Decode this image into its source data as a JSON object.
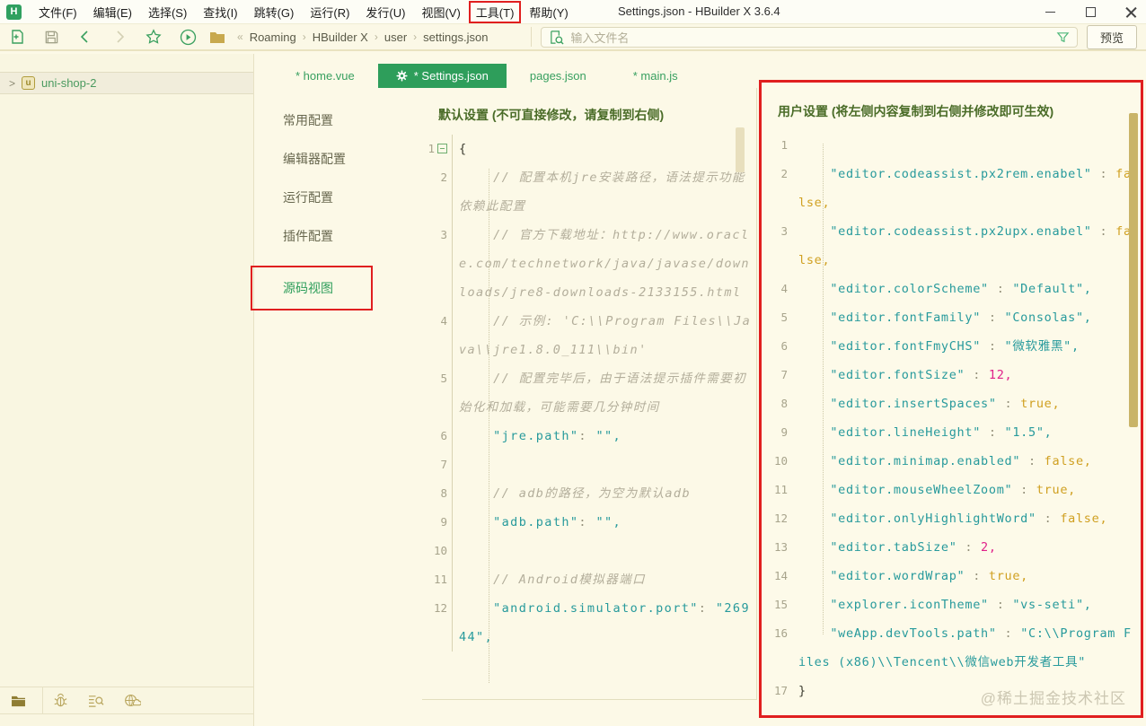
{
  "window": {
    "title": "Settings.json - HBuilder X 3.6.4",
    "app_icon_letter": "H"
  },
  "menu": {
    "items": [
      "文件(F)",
      "编辑(E)",
      "选择(S)",
      "查找(I)",
      "跳转(G)",
      "运行(R)",
      "发行(U)",
      "视图(V)",
      "工具(T)",
      "帮助(Y)"
    ],
    "highlight_index": 8
  },
  "toolbar": {
    "breadcrumb_prefix": "«",
    "breadcrumb_separator": "›",
    "breadcrumb": [
      "Roaming",
      "HBuilder X",
      "user",
      "settings.json"
    ],
    "search_placeholder": "输入文件名",
    "preview_label": "预览"
  },
  "sidebar": {
    "project_name": "uni-shop-2",
    "project_icon_letter": "u",
    "tree_chevron": ">"
  },
  "tabs": [
    {
      "label": "* home.vue",
      "active": false
    },
    {
      "label": "* Settings.json",
      "active": true,
      "gear": true
    },
    {
      "label": "pages.json",
      "active": false
    },
    {
      "label": "* main.js",
      "active": false
    }
  ],
  "settings_nav": {
    "items": [
      "常用配置",
      "编辑器配置",
      "运行配置",
      "插件配置",
      "源码视图"
    ],
    "active_index": 4
  },
  "default_panel": {
    "title": "默认设置 (不可直接修改，请复制到右侧)",
    "lines": [
      {
        "n": 1,
        "fold": true,
        "tokens": [
          {
            "c": "br",
            "t": "{"
          }
        ]
      },
      {
        "n": 2,
        "tokens": [
          {
            "c": "cm",
            "t": "    // 配置本机jre安装路径，语法提示功能依赖此配置"
          }
        ]
      },
      {
        "n": 3,
        "tokens": [
          {
            "c": "cm",
            "t": "    // 官方下载地址：http://www.oracle.com/technetwork/java/javase/downloads/jre8-downloads-2133155.html"
          }
        ]
      },
      {
        "n": 4,
        "tokens": [
          {
            "c": "cm",
            "t": "    // 示例: 'C:\\\\Program Files\\\\Java\\\\jre1.8.0_111\\\\bin'"
          }
        ]
      },
      {
        "n": 5,
        "tokens": [
          {
            "c": "cm",
            "t": "    // 配置完毕后，由于语法提示插件需要初始化和加载，可能需要几分钟时间"
          }
        ]
      },
      {
        "n": 6,
        "tokens": [
          {
            "c": "pl",
            "t": "    "
          },
          {
            "c": "k",
            "t": "\"jre.path\""
          },
          {
            "c": "p",
            "t": ": "
          },
          {
            "c": "s",
            "t": "\"\","
          }
        ]
      },
      {
        "n": 7,
        "tokens": []
      },
      {
        "n": 8,
        "tokens": [
          {
            "c": "cm",
            "t": "    // adb的路径，为空为默认adb"
          }
        ]
      },
      {
        "n": 9,
        "tokens": [
          {
            "c": "pl",
            "t": "    "
          },
          {
            "c": "k",
            "t": "\"adb.path\""
          },
          {
            "c": "p",
            "t": ": "
          },
          {
            "c": "s",
            "t": "\"\","
          }
        ]
      },
      {
        "n": 10,
        "tokens": []
      },
      {
        "n": 11,
        "tokens": [
          {
            "c": "cm",
            "t": "    // Android模拟器端口"
          }
        ]
      },
      {
        "n": 12,
        "tokens": [
          {
            "c": "pl",
            "t": "    "
          },
          {
            "c": "k",
            "t": "\"android.simulator.port\""
          },
          {
            "c": "p",
            "t": ": "
          },
          {
            "c": "s",
            "t": "\"26944\","
          }
        ]
      }
    ]
  },
  "user_panel": {
    "title": "用户设置 (将左侧内容复制到右侧并修改即可生效)",
    "lines": [
      {
        "n": 1,
        "tokens": []
      },
      {
        "n": 2,
        "tokens": [
          {
            "c": "pl",
            "t": "    "
          },
          {
            "c": "k",
            "t": "\"editor.codeassist.px2rem.enabel\""
          },
          {
            "c": "p",
            "t": " : "
          },
          {
            "c": "b",
            "t": "false,"
          }
        ]
      },
      {
        "n": 3,
        "tokens": [
          {
            "c": "pl",
            "t": "    "
          },
          {
            "c": "k",
            "t": "\"editor.codeassist.px2upx.enabel\""
          },
          {
            "c": "p",
            "t": " : "
          },
          {
            "c": "b",
            "t": "false,"
          }
        ]
      },
      {
        "n": 4,
        "tokens": [
          {
            "c": "pl",
            "t": "    "
          },
          {
            "c": "k",
            "t": "\"editor.colorScheme\""
          },
          {
            "c": "p",
            "t": " : "
          },
          {
            "c": "s",
            "t": "\"Default\","
          }
        ]
      },
      {
        "n": 5,
        "tokens": [
          {
            "c": "pl",
            "t": "    "
          },
          {
            "c": "k",
            "t": "\"editor.fontFamily\""
          },
          {
            "c": "p",
            "t": " : "
          },
          {
            "c": "s",
            "t": "\"Consolas\","
          }
        ]
      },
      {
        "n": 6,
        "tokens": [
          {
            "c": "pl",
            "t": "    "
          },
          {
            "c": "k",
            "t": "\"editor.fontFmyCHS\""
          },
          {
            "c": "p",
            "t": " : "
          },
          {
            "c": "s",
            "t": "\"微软雅黑\","
          }
        ]
      },
      {
        "n": 7,
        "tokens": [
          {
            "c": "pl",
            "t": "    "
          },
          {
            "c": "k",
            "t": "\"editor.fontSize\""
          },
          {
            "c": "p",
            "t": " : "
          },
          {
            "c": "n",
            "t": "12,"
          }
        ]
      },
      {
        "n": 8,
        "tokens": [
          {
            "c": "pl",
            "t": "    "
          },
          {
            "c": "k",
            "t": "\"editor.insertSpaces\""
          },
          {
            "c": "p",
            "t": " : "
          },
          {
            "c": "b",
            "t": "true,"
          }
        ]
      },
      {
        "n": 9,
        "tokens": [
          {
            "c": "pl",
            "t": "    "
          },
          {
            "c": "k",
            "t": "\"editor.lineHeight\""
          },
          {
            "c": "p",
            "t": " : "
          },
          {
            "c": "s",
            "t": "\"1.5\","
          }
        ]
      },
      {
        "n": 10,
        "tokens": [
          {
            "c": "pl",
            "t": "    "
          },
          {
            "c": "k",
            "t": "\"editor.minimap.enabled\""
          },
          {
            "c": "p",
            "t": " : "
          },
          {
            "c": "b",
            "t": "false,"
          }
        ]
      },
      {
        "n": 11,
        "tokens": [
          {
            "c": "pl",
            "t": "    "
          },
          {
            "c": "k",
            "t": "\"editor.mouseWheelZoom\""
          },
          {
            "c": "p",
            "t": " : "
          },
          {
            "c": "b",
            "t": "true,"
          }
        ]
      },
      {
        "n": 12,
        "tokens": [
          {
            "c": "pl",
            "t": "    "
          },
          {
            "c": "k",
            "t": "\"editor.onlyHighlightWord\""
          },
          {
            "c": "p",
            "t": " : "
          },
          {
            "c": "b",
            "t": "false,"
          }
        ]
      },
      {
        "n": 13,
        "tokens": [
          {
            "c": "pl",
            "t": "    "
          },
          {
            "c": "k",
            "t": "\"editor.tabSize\""
          },
          {
            "c": "p",
            "t": " : "
          },
          {
            "c": "n",
            "t": "2,"
          }
        ]
      },
      {
        "n": 14,
        "tokens": [
          {
            "c": "pl",
            "t": "    "
          },
          {
            "c": "k",
            "t": "\"editor.wordWrap\""
          },
          {
            "c": "p",
            "t": " : "
          },
          {
            "c": "b",
            "t": "true,"
          }
        ]
      },
      {
        "n": 15,
        "tokens": [
          {
            "c": "pl",
            "t": "    "
          },
          {
            "c": "k",
            "t": "\"explorer.iconTheme\""
          },
          {
            "c": "p",
            "t": " : "
          },
          {
            "c": "s",
            "t": "\"vs-seti\","
          }
        ]
      },
      {
        "n": 16,
        "tokens": [
          {
            "c": "pl",
            "t": "    "
          },
          {
            "c": "k",
            "t": "\"weApp.devTools.path\""
          },
          {
            "c": "p",
            "t": " : "
          },
          {
            "c": "s",
            "t": "\"C:\\\\Program Files (x86)\\\\Tencent\\\\微信web开发者工具\""
          }
        ]
      },
      {
        "n": 17,
        "tokens": [
          {
            "c": "br",
            "t": "}"
          }
        ]
      }
    ]
  },
  "watermark": "@稀土掘金技术社区",
  "colors": {
    "accent_green": "#2e9e5b",
    "annotation_red": "#e01f1f",
    "string_teal": "#279a9c",
    "bool_gold": "#d0a021",
    "number_magenta": "#e0218a",
    "comment_gray": "#b3ae9b",
    "background_cream": "#fcf9e7"
  }
}
